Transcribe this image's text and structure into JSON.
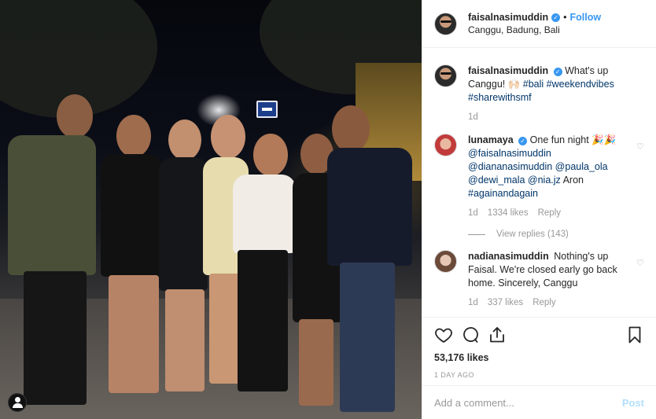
{
  "post": {
    "author": {
      "username": "faisalnasimuddin",
      "verified_icon": "verified-badge-icon",
      "separator": "•",
      "follow_label": "Follow",
      "location": "Canggu, Badung, Bali"
    },
    "caption": {
      "username": "faisalnasimuddin",
      "text": "What's up Canggu! 🙌🏻 ",
      "hashtags": "#bali #weekendvibes #sharewithsmf",
      "time": "1d"
    },
    "comments": [
      {
        "username": "lunamaya",
        "text_prefix": "One fun night 🎉🎉 ",
        "mentions": "@faisalnasimuddin @diananasimuddin @paula_ola @dewi_mala @nia.jz",
        "text_suffix": " Aron ",
        "hashtag": "#againandagain",
        "time": "1d",
        "likes": "1334 likes",
        "reply_label": "Reply",
        "view_replies": "View replies (143)"
      },
      {
        "username": "nadianasimuddin",
        "text": "Nothing's up Faisal. We're closed early go back home. Sincerely, Canggu",
        "time": "1d",
        "likes": "337 likes",
        "reply_label": "Reply"
      }
    ],
    "likes_count": "53,176 likes",
    "posted_ago": "1 DAY AGO",
    "add_comment_placeholder": "Add a comment...",
    "post_button": "Post"
  },
  "colors": {
    "link": "#003569",
    "follow": "#3897f0",
    "muted": "#999999",
    "post_disabled": "#b2dffc"
  }
}
